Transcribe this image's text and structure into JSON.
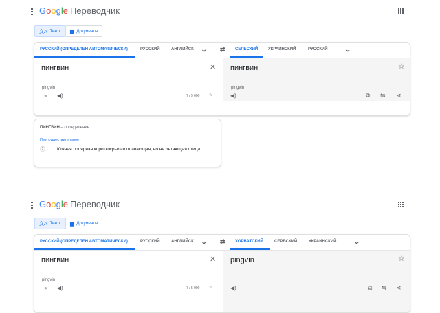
{
  "top": {
    "logo": {
      "g": "G",
      "o1": "o",
      "o2": "o",
      "g2": "g",
      "l": "l",
      "e": "e",
      "product": "Переводчик"
    },
    "modes": {
      "text_label": "Текст",
      "docs_label": "Документы"
    },
    "source_langs": [
      "РУССКИЙ (ОПРЕДЕЛЕН АВТОМАТИЧЕСКИ)",
      "РУССКИЙ",
      "АНГЛИЙСК"
    ],
    "target_langs": [
      "СЕРБСКИЙ",
      "УКРАИНСКИЙ",
      "РУССКИЙ"
    ],
    "source_text": "пингвин",
    "transliteration": "pingvin",
    "char_count": "7 / 5 000",
    "translation": "пингвин",
    "target_transliteration": "pingvin",
    "definition": {
      "word": "ПИНГВИН",
      "suffix": "– определение",
      "part_of_speech": "Имя существительное",
      "number": "1",
      "text": "Южная полярная короткокрылая плавающая, но не летающая птица."
    }
  },
  "bottom": {
    "logo": {
      "g": "G",
      "o1": "o",
      "o2": "o",
      "g2": "g",
      "l": "l",
      "e": "e",
      "product": "Переводчик"
    },
    "modes": {
      "text_label": "Текст",
      "docs_label": "Документы"
    },
    "source_langs": [
      "РУССКИЙ (ОПРЕДЕЛЕН АВТОМАТИЧЕСКИ)",
      "РУССКИЙ",
      "АНГЛИЙСК"
    ],
    "target_langs": [
      "ХОРВАТСКИЙ",
      "СЕРБСКИЙ",
      "УКРАИНСКИЙ"
    ],
    "source_text": "пингвин",
    "transliteration": "pingvin",
    "char_count": "7 / 5 000",
    "translation": "pingvin"
  },
  "icons": {
    "text_mode": "translate-icon",
    "docs_mode": "document-icon",
    "swap": "swap-icon",
    "clear": "close-icon",
    "mic": "mic-icon",
    "speaker": "speaker-icon",
    "edit": "pencil-icon",
    "star": "star-icon",
    "copy": "copy-icon",
    "feedback": "feedback-icon",
    "share": "share-icon"
  },
  "colors": {
    "accent": "#1a73e8",
    "target_bg": "#f5f5f5",
    "active_mode_bg": "#e8f0fe"
  }
}
